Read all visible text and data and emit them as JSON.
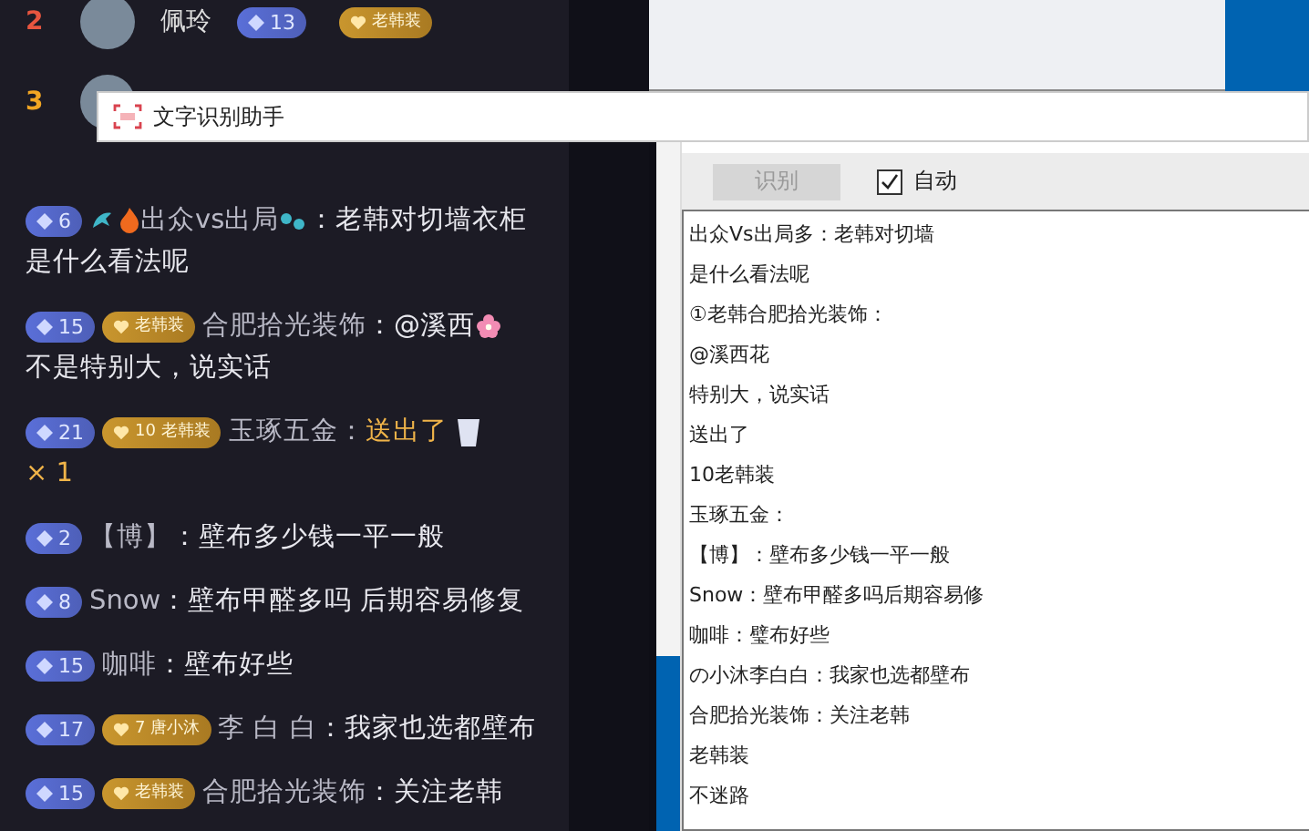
{
  "ranking": [
    {
      "rank": "2",
      "color": "#e8553f",
      "name": "佩玲",
      "level": "13",
      "fan_badge": "老韩装"
    },
    {
      "rank": "3",
      "color": "#f2a623"
    }
  ],
  "messages": [
    {
      "kind": "chat",
      "level": "6",
      "name": "出众vs出局",
      "name_icons": true,
      "text": "：老韩对切墙衣柜是什么看法呢"
    },
    {
      "kind": "chat",
      "level": "15",
      "fan_badge": "老韩装",
      "name": "合肥拾光装饰",
      "text": "：@溪西",
      "text_icon": true,
      "text_more": "不是特别大，说实话"
    },
    {
      "kind": "gift",
      "level": "21",
      "fan_level": "10",
      "fan_badge": "老韩装",
      "name": "玉琢五金：",
      "text": "送出了",
      "count": "× 1"
    },
    {
      "kind": "chat",
      "level": "2",
      "name": "【博】",
      "text": "：壁布多少钱一平一般"
    },
    {
      "kind": "chat",
      "level": "8",
      "name": "Snow",
      "text": "：壁布甲醛多吗 后期容易修复"
    },
    {
      "kind": "chat",
      "level": "15",
      "name": "咖啡",
      "text": "：壁布好些"
    },
    {
      "kind": "chat",
      "level": "17",
      "fan_level": "7",
      "fan_badge": "唐小沐",
      "name": "李 白 白",
      "text": "：我家也选都壁布"
    },
    {
      "kind": "chat",
      "level": "15",
      "fan_badge": "老韩装",
      "name": "合肥拾光装饰",
      "text": "：关注老韩"
    }
  ],
  "ocr_window": {
    "title": "文字识别助手",
    "recognize_button": {
      "label": "识别",
      "disabled": true
    },
    "auto": {
      "label": "自动",
      "checked": true
    },
    "lines": [
      "出众Vs出局多：老韩对切墙",
      "是什么看法呢",
      "①老韩合肥拾光装饰：",
      "@溪西花",
      "特别大，说实话",
      "送出了",
      "10老韩装",
      "玉琢五金：",
      "【博】：壁布多少钱一平一般",
      "Snow：壁布甲醛多吗后期容易修",
      "咖啡：璧布好些",
      "の小沐李白白：我家也选都壁布",
      "合肥拾光装饰：关注老韩",
      "老韩装",
      "不迷路"
    ]
  }
}
